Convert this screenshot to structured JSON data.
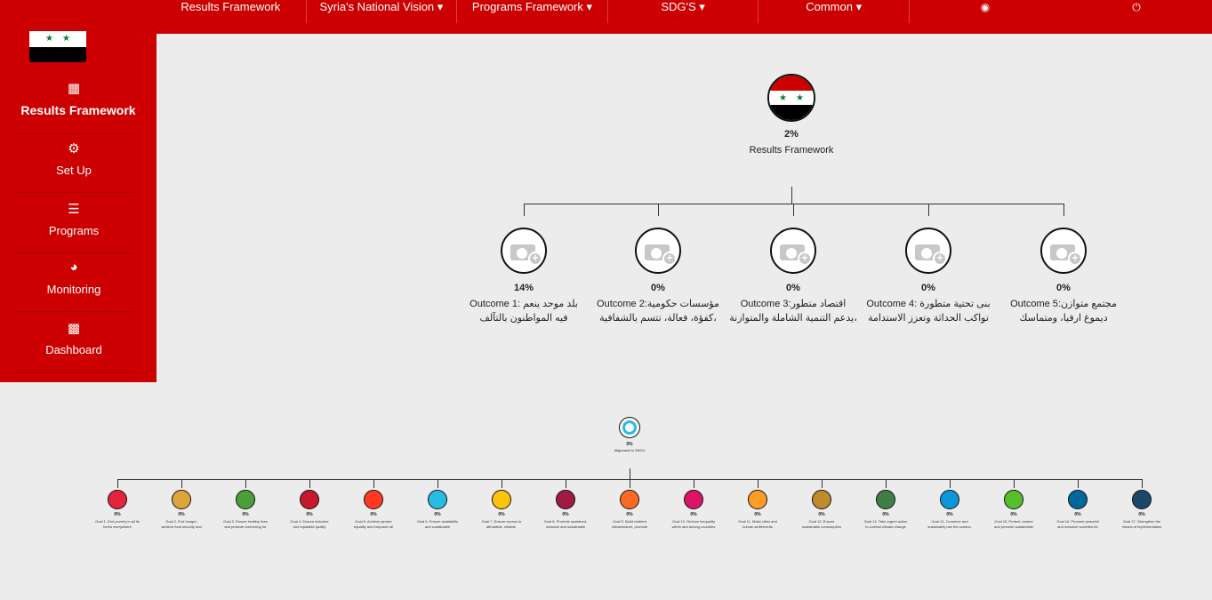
{
  "topnav": {
    "items": [
      "Results Framework",
      "Syria's National Vision ▾",
      "Programs Framework ▾",
      "SDG'S ▾",
      "Common ▾"
    ],
    "icons": [
      "chat-icon",
      "power-icon"
    ]
  },
  "sidebar": {
    "items": [
      {
        "label": "Results Framework",
        "icon": "puzzle-icon"
      },
      {
        "label": "Set Up",
        "icon": "gear-icon"
      },
      {
        "label": "Programs",
        "icon": "list-icon"
      },
      {
        "label": "Monitoring",
        "icon": "gauge-icon"
      },
      {
        "label": "Dashboard",
        "icon": "bar-chart-icon"
      }
    ]
  },
  "flag": {
    "colors": [
      "#cc0000",
      "#ffffff",
      "#000000"
    ],
    "star_color": "#0a7c2f"
  },
  "results": {
    "root": {
      "pct": "2%",
      "label": "Results Framework"
    },
    "outcomes": [
      {
        "pct": "14%",
        "line1": "Outcome 1: بلد موحد ينعم",
        "line2": "فيه المواطنون بالتآلف"
      },
      {
        "pct": "0%",
        "line1": "Outcome 2:مؤسسات حكومية",
        "line2": "كفؤة، فعالة، تتسم بالشفافية،"
      },
      {
        "pct": "0%",
        "line1": "Outcome 3:اقتصاد متطور",
        "line2": "يدعم التنمية الشاملة والمتوازنة،"
      },
      {
        "pct": "0%",
        "line1": "Outcome 4: بنى تحتية متطورة",
        "line2": "تواكب الحداثة وتعزز الاستدامة"
      },
      {
        "pct": "0%",
        "line1": "Outcome 5:مجتمع متوازن",
        "line2": "ديموغ ارفيا، ومتماسك"
      }
    ]
  },
  "sdg": {
    "root": {
      "pct": "0%",
      "label": "Alignment to SDG's"
    },
    "goals": [
      {
        "pct": "0%",
        "l1": "Goal 1. End poverty in all its",
        "l2": "forms everywhere",
        "color": "#e5243b"
      },
      {
        "pct": "0%",
        "l1": "Goal 2. End hunger,",
        "l2": "achieve food security and",
        "color": "#dda63a"
      },
      {
        "pct": "0%",
        "l1": "Goal 3. Ensure healthy lives",
        "l2": "and promote well-being for",
        "color": "#4c9f38"
      },
      {
        "pct": "0%",
        "l1": "Goal 4. Ensure inclusive",
        "l2": "and equitable quality",
        "color": "#c5192d"
      },
      {
        "pct": "0%",
        "l1": "Goal 5. Achieve gender",
        "l2": "equality and empower all",
        "color": "#ff3a21"
      },
      {
        "pct": "0%",
        "l1": "Goal 6. Ensure availability",
        "l2": "and sustainable",
        "color": "#26bde2"
      },
      {
        "pct": "0%",
        "l1": "Goal 7. Ensure access to",
        "l2": "affordable, reliable,",
        "color": "#fcc30b"
      },
      {
        "pct": "0%",
        "l1": "Goal 8. Promote sustained,",
        "l2": "inclusive and sustainable",
        "color": "#a21942"
      },
      {
        "pct": "0%",
        "l1": "Goal 9. Build resilient",
        "l2": "infrastructure, promote",
        "color": "#fd6925"
      },
      {
        "pct": "0%",
        "l1": "Goal 10. Reduce inequality",
        "l2": "within and among countries",
        "color": "#dd1367"
      },
      {
        "pct": "0%",
        "l1": "Goal 11. Make cities and",
        "l2": "human settlements",
        "color": "#fd9d24"
      },
      {
        "pct": "0%",
        "l1": "Goal 12. Ensure",
        "l2": "sustainable consumption",
        "color": "#bf8b2e"
      },
      {
        "pct": "0%",
        "l1": "Goal 13. Take urgent action",
        "l2": "to combat climate change",
        "color": "#3f7e44"
      },
      {
        "pct": "0%",
        "l1": "Goal 14. Conserve and",
        "l2": "sustainably use the oceans,",
        "color": "#0a97d9"
      },
      {
        "pct": "0%",
        "l1": "Goal 15. Protect, restore",
        "l2": "and promote sustainable",
        "color": "#56c02b"
      },
      {
        "pct": "0%",
        "l1": "Goal 16. Promote peaceful",
        "l2": "and inclusive societies for",
        "color": "#00689d"
      },
      {
        "pct": "0%",
        "l1": "Goal 17. Strengthen the",
        "l2": "means of implementation",
        "color": "#19486a"
      }
    ]
  }
}
